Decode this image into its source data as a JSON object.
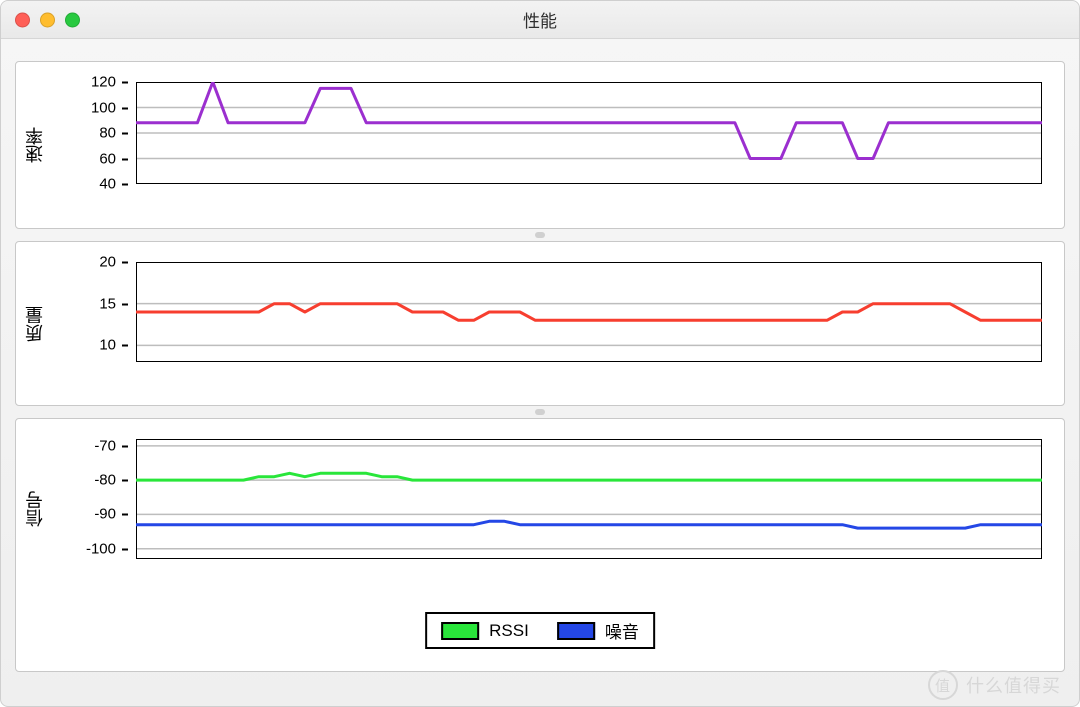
{
  "window": {
    "title": "性能"
  },
  "panels": {
    "rate": {
      "ylabel": "速率"
    },
    "quality": {
      "ylabel": "质量"
    },
    "signal": {
      "ylabel": "信号"
    }
  },
  "legend": {
    "rssi": "RSSI",
    "noise": "噪音"
  },
  "watermark": {
    "text": "什么值得买",
    "badge": "值"
  },
  "colors": {
    "rate": "#9b2fcf",
    "quality": "#f73e2f",
    "rssi": "#29e63a",
    "noise": "#2447e6",
    "grid": "#bdbdbd",
    "axis": "#000000"
  },
  "chart_data": [
    {
      "type": "line",
      "title": "速率",
      "ylabel": "速率",
      "ylim": [
        40,
        120
      ],
      "yticks": [
        40,
        60,
        80,
        100,
        120
      ],
      "x": [
        0,
        1,
        2,
        3,
        4,
        5,
        6,
        7,
        8,
        9,
        10,
        11,
        12,
        13,
        14,
        15,
        16,
        17,
        18,
        19,
        20,
        21,
        22,
        23,
        24,
        25,
        26,
        27,
        28,
        29,
        30,
        31,
        32,
        33,
        34,
        35,
        36,
        37,
        38,
        39,
        40,
        41,
        42,
        43,
        44,
        45,
        46,
        47,
        48,
        49,
        50,
        51,
        52,
        53,
        54,
        55,
        56,
        57,
        58,
        59
      ],
      "series": [
        {
          "name": "速率",
          "color": "#9b2fcf",
          "values": [
            88,
            88,
            88,
            88,
            88,
            120,
            88,
            88,
            88,
            88,
            88,
            88,
            115,
            115,
            115,
            88,
            88,
            88,
            88,
            88,
            88,
            88,
            88,
            88,
            88,
            88,
            88,
            88,
            88,
            88,
            88,
            88,
            88,
            88,
            88,
            88,
            88,
            88,
            88,
            88,
            60,
            60,
            60,
            88,
            88,
            88,
            88,
            60,
            60,
            88,
            88,
            88,
            88,
            88,
            88,
            88,
            88,
            88,
            88,
            88
          ]
        }
      ]
    },
    {
      "type": "line",
      "title": "质量",
      "ylabel": "质量",
      "ylim": [
        8,
        20
      ],
      "yticks": [
        10,
        15,
        20
      ],
      "x": [
        0,
        1,
        2,
        3,
        4,
        5,
        6,
        7,
        8,
        9,
        10,
        11,
        12,
        13,
        14,
        15,
        16,
        17,
        18,
        19,
        20,
        21,
        22,
        23,
        24,
        25,
        26,
        27,
        28,
        29,
        30,
        31,
        32,
        33,
        34,
        35,
        36,
        37,
        38,
        39,
        40,
        41,
        42,
        43,
        44,
        45,
        46,
        47,
        48,
        49,
        50,
        51,
        52,
        53,
        54,
        55,
        56,
        57,
        58,
        59
      ],
      "series": [
        {
          "name": "质量",
          "color": "#f73e2f",
          "values": [
            14,
            14,
            14,
            14,
            14,
            14,
            14,
            14,
            14,
            15,
            15,
            14,
            15,
            15,
            15,
            15,
            15,
            15,
            14,
            14,
            14,
            13,
            13,
            14,
            14,
            14,
            13,
            13,
            13,
            13,
            13,
            13,
            13,
            13,
            13,
            13,
            13,
            13,
            13,
            13,
            13,
            13,
            13,
            13,
            13,
            13,
            14,
            14,
            15,
            15,
            15,
            15,
            15,
            15,
            14,
            13,
            13,
            13,
            13,
            13
          ]
        }
      ]
    },
    {
      "type": "line",
      "title": "信号",
      "ylabel": "信号",
      "ylim": [
        -103,
        -68
      ],
      "yticks": [
        -100,
        -90,
        -80,
        -70
      ],
      "x": [
        0,
        1,
        2,
        3,
        4,
        5,
        6,
        7,
        8,
        9,
        10,
        11,
        12,
        13,
        14,
        15,
        16,
        17,
        18,
        19,
        20,
        21,
        22,
        23,
        24,
        25,
        26,
        27,
        28,
        29,
        30,
        31,
        32,
        33,
        34,
        35,
        36,
        37,
        38,
        39,
        40,
        41,
        42,
        43,
        44,
        45,
        46,
        47,
        48,
        49,
        50,
        51,
        52,
        53,
        54,
        55,
        56,
        57,
        58,
        59
      ],
      "series": [
        {
          "name": "RSSI",
          "color": "#29e63a",
          "values": [
            -80,
            -80,
            -80,
            -80,
            -80,
            -80,
            -80,
            -80,
            -79,
            -79,
            -78,
            -79,
            -78,
            -78,
            -78,
            -78,
            -79,
            -79,
            -80,
            -80,
            -80,
            -80,
            -80,
            -80,
            -80,
            -80,
            -80,
            -80,
            -80,
            -80,
            -80,
            -80,
            -80,
            -80,
            -80,
            -80,
            -80,
            -80,
            -80,
            -80,
            -80,
            -80,
            -80,
            -80,
            -80,
            -80,
            -80,
            -80,
            -80,
            -80,
            -80,
            -80,
            -80,
            -80,
            -80,
            -80,
            -80,
            -80,
            -80,
            -80
          ]
        },
        {
          "name": "噪音",
          "color": "#2447e6",
          "values": [
            -93,
            -93,
            -93,
            -93,
            -93,
            -93,
            -93,
            -93,
            -93,
            -93,
            -93,
            -93,
            -93,
            -93,
            -93,
            -93,
            -93,
            -93,
            -93,
            -93,
            -93,
            -93,
            -93,
            -92,
            -92,
            -93,
            -93,
            -93,
            -93,
            -93,
            -93,
            -93,
            -93,
            -93,
            -93,
            -93,
            -93,
            -93,
            -93,
            -93,
            -93,
            -93,
            -93,
            -93,
            -93,
            -93,
            -93,
            -94,
            -94,
            -94,
            -94,
            -94,
            -94,
            -94,
            -94,
            -93,
            -93,
            -93,
            -93,
            -93
          ]
        }
      ]
    }
  ]
}
